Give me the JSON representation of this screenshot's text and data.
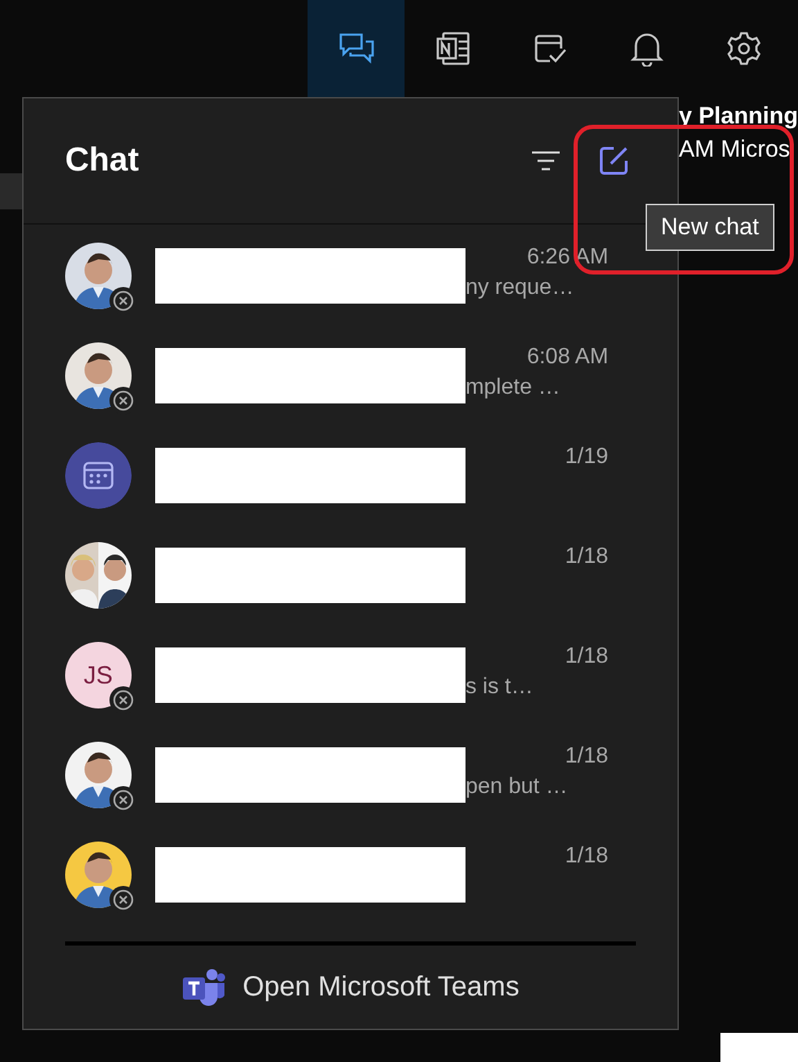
{
  "top_bar": {
    "icons": [
      {
        "kind": "chat",
        "selected": true
      },
      {
        "kind": "notes",
        "selected": false
      },
      {
        "kind": "calendar-check",
        "selected": false
      },
      {
        "kind": "bell",
        "selected": false
      },
      {
        "kind": "gear",
        "selected": false
      }
    ]
  },
  "background_text": {
    "title": "y Planning",
    "subtitle": "AM Micros"
  },
  "chat_panel": {
    "title": "Chat",
    "rows": [
      {
        "offline": true,
        "time": "6:26 AM",
        "preview": "ny reque…"
      },
      {
        "offline": true,
        "time": "6:08 AM",
        "preview": "mplete …"
      },
      {
        "avatar": {
          "kind": "meeting"
        },
        "offline": false,
        "time": "1/19"
      },
      {
        "avatar": {
          "kind": "group"
        },
        "offline": false,
        "time": "1/18"
      },
      {
        "avatar": {
          "kind": "initials",
          "initials": "JS"
        },
        "offline": true,
        "time": "1/18",
        "preview": "s is t…"
      },
      {
        "offline": true,
        "time": "1/18",
        "preview": "pen but …"
      },
      {
        "offline": true,
        "time": "1/18"
      }
    ],
    "footer": {
      "label": "Open Microsoft Teams"
    }
  },
  "tooltip": {
    "text": "New chat"
  }
}
